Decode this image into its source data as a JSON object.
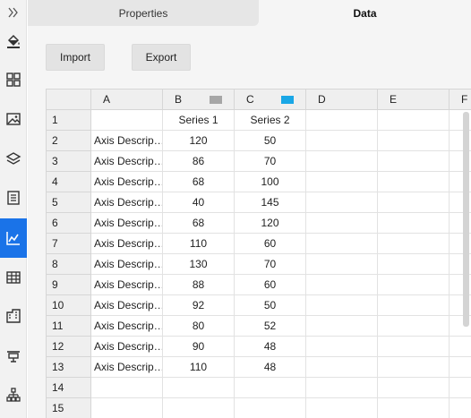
{
  "rail": {
    "items": [
      {
        "name": "fill-icon"
      },
      {
        "name": "layout-icon"
      },
      {
        "name": "image-icon"
      },
      {
        "name": "layers-icon"
      },
      {
        "name": "document-icon"
      },
      {
        "name": "chart-icon",
        "active": true
      },
      {
        "name": "table-icon"
      },
      {
        "name": "building-icon"
      },
      {
        "name": "presentation-icon"
      },
      {
        "name": "hierarchy-icon"
      }
    ],
    "accent": "#1a73e8"
  },
  "tabs": {
    "properties": "Properties",
    "data": "Data"
  },
  "toolbar": {
    "import_label": "Import",
    "export_label": "Export"
  },
  "grid": {
    "columns": [
      {
        "letter": "A"
      },
      {
        "letter": "B",
        "swatch": "#a6a6a6"
      },
      {
        "letter": "C",
        "swatch": "#1aa7e6"
      },
      {
        "letter": "D"
      },
      {
        "letter": "E"
      },
      {
        "letter": "F"
      }
    ],
    "row_numbers": [
      "1",
      "2",
      "3",
      "4",
      "5",
      "6",
      "7",
      "8",
      "9",
      "10",
      "11",
      "12",
      "13",
      "14",
      "15"
    ],
    "rows": [
      [
        "",
        "Series 1",
        "Series 2"
      ],
      [
        "Axis Descrip…",
        "120",
        "50"
      ],
      [
        "Axis Descrip…",
        "86",
        "70"
      ],
      [
        "Axis Descrip…",
        "68",
        "100"
      ],
      [
        "Axis Descrip…",
        "40",
        "145"
      ],
      [
        "Axis Descrip…",
        "68",
        "120"
      ],
      [
        "Axis Descrip…",
        "110",
        "60"
      ],
      [
        "Axis Descrip…",
        "130",
        "70"
      ],
      [
        "Axis Descrip…",
        "88",
        "60"
      ],
      [
        "Axis Descrip…",
        "92",
        "50"
      ],
      [
        "Axis Descrip…",
        "80",
        "52"
      ],
      [
        "Axis Descrip…",
        "90",
        "48"
      ],
      [
        "Axis Descrip…",
        "110",
        "48"
      ],
      [
        "",
        "",
        ""
      ],
      [
        "",
        "",
        ""
      ]
    ]
  }
}
